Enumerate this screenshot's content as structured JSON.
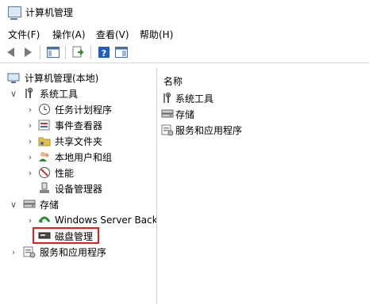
{
  "window": {
    "title": "计算机管理"
  },
  "menu": [
    "文件(F)",
    "操作(A)",
    "查看(V)",
    "帮助(H)"
  ],
  "tree": {
    "root": "计算机管理(本地)",
    "system_tools": {
      "label": "系统工具",
      "children": [
        "任务计划程序",
        "事件查看器",
        "共享文件夹",
        "本地用户和组",
        "性能",
        "设备管理器"
      ]
    },
    "storage": {
      "label": "存储",
      "children": [
        "Windows Server Back",
        "磁盘管理"
      ]
    },
    "services": "服务和应用程序"
  },
  "right": {
    "header": "名称",
    "items": [
      "系统工具",
      "存储",
      "服务和应用程序"
    ]
  },
  "colors": {
    "highlight_border": "#e02020"
  }
}
